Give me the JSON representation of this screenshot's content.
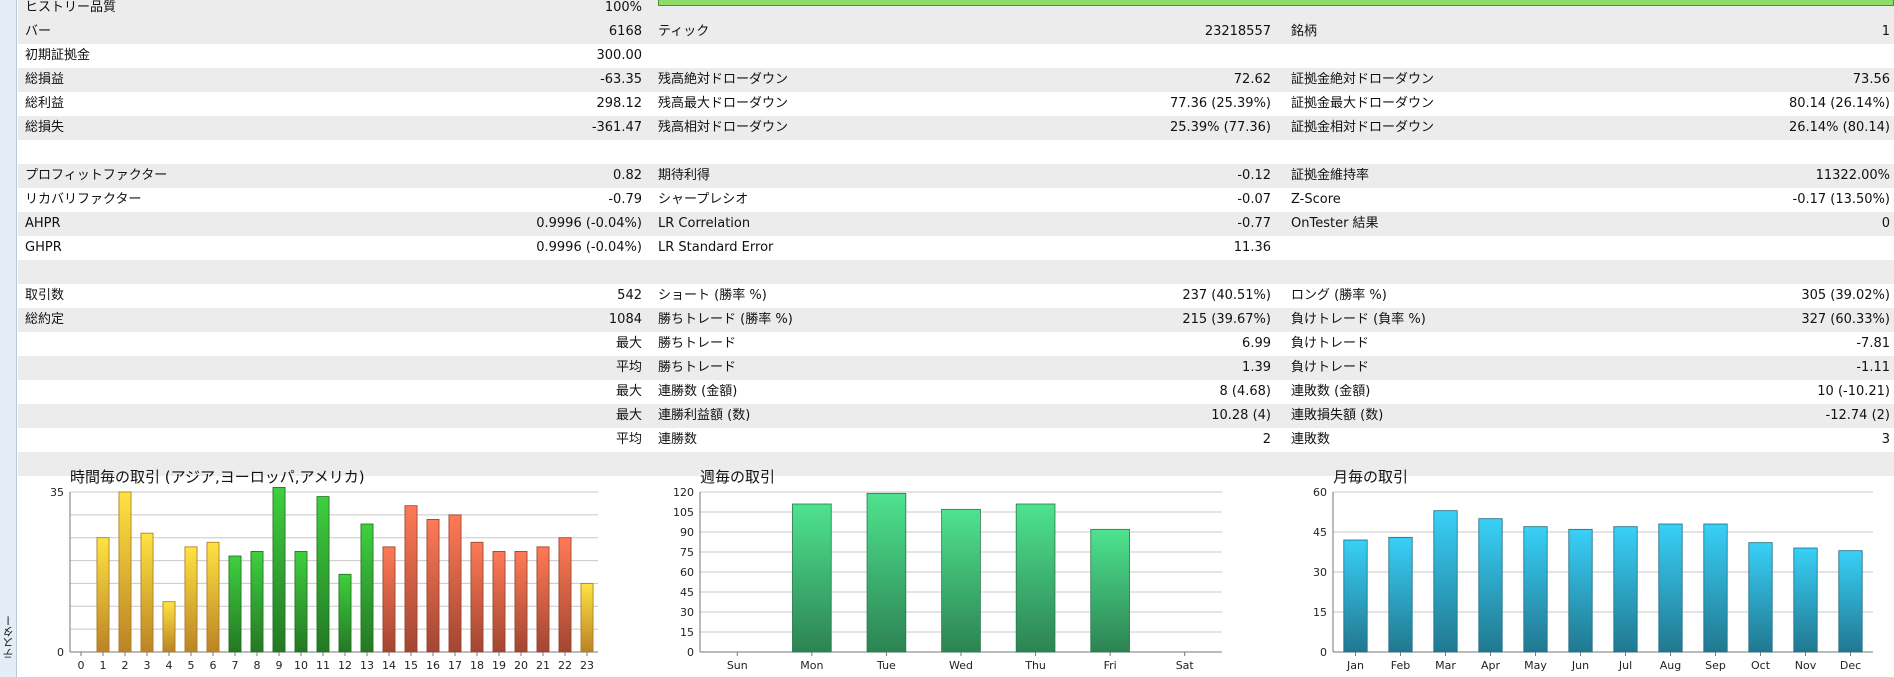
{
  "sidebar": {
    "label": "テスター"
  },
  "report": {
    "rows": [
      {
        "shade": true,
        "cells": [
          "ヒストリー品質",
          "100%",
          "",
          "",
          "",
          ""
        ]
      },
      {
        "shade": true,
        "cells": [
          "バー",
          "6168",
          "ティック",
          "23218557",
          "銘柄",
          "1"
        ]
      },
      {
        "shade": false,
        "cells": [
          "初期証拠金",
          "300.00",
          "",
          "",
          "",
          ""
        ]
      },
      {
        "shade": true,
        "cells": [
          "総損益",
          "-63.35",
          "残高絶対ドローダウン",
          "72.62",
          "証拠金絶対ドローダウン",
          "73.56"
        ]
      },
      {
        "shade": false,
        "cells": [
          "総利益",
          "298.12",
          "残高最大ドローダウン",
          "77.36 (25.39%)",
          "証拠金最大ドローダウン",
          "80.14 (26.14%)"
        ]
      },
      {
        "shade": true,
        "cells": [
          "総損失",
          "-361.47",
          "残高相対ドローダウン",
          "25.39% (77.36)",
          "証拠金相対ドローダウン",
          "26.14% (80.14)"
        ]
      },
      {
        "shade": false,
        "cells": [
          "",
          "",
          "",
          "",
          "",
          ""
        ]
      },
      {
        "shade": true,
        "cells": [
          "プロフィットファクター",
          "0.82",
          "期待利得",
          "-0.12",
          "証拠金維持率",
          "11322.00%"
        ]
      },
      {
        "shade": false,
        "cells": [
          "リカバリファクター",
          "-0.79",
          "シャープレシオ",
          "-0.07",
          "Z-Score",
          "-0.17 (13.50%)"
        ]
      },
      {
        "shade": true,
        "cells": [
          "AHPR",
          "0.9996 (-0.04%)",
          "LR Correlation",
          "-0.77",
          "OnTester 結果",
          "0"
        ]
      },
      {
        "shade": false,
        "cells": [
          "GHPR",
          "0.9996 (-0.04%)",
          "LR Standard Error",
          "11.36",
          "",
          ""
        ]
      },
      {
        "shade": true,
        "cells": [
          "",
          "",
          "",
          "",
          "",
          ""
        ]
      },
      {
        "shade": false,
        "cells": [
          "取引数",
          "542",
          "ショート (勝率 %)",
          "237 (40.51%)",
          "ロング (勝率 %)",
          "305 (39.02%)"
        ]
      },
      {
        "shade": true,
        "cells": [
          "総約定",
          "1084",
          "勝ちトレード (勝率 %)",
          "215 (39.67%)",
          "負けトレード (負率 %)",
          "327 (60.33%)"
        ]
      },
      {
        "shade": false,
        "cells": [
          "",
          "最大",
          "勝ちトレード",
          "6.99",
          "負けトレード",
          "-7.81"
        ]
      },
      {
        "shade": true,
        "cells": [
          "",
          "平均",
          "勝ちトレード",
          "1.39",
          "負けトレード",
          "-1.11"
        ]
      },
      {
        "shade": false,
        "cells": [
          "",
          "最大",
          "連勝数 (金額)",
          "8 (4.68)",
          "連敗数 (金額)",
          "10 (-10.21)"
        ]
      },
      {
        "shade": true,
        "cells": [
          "",
          "最大",
          "連勝利益額 (数)",
          "10.28 (4)",
          "連敗損失額 (数)",
          "-12.74 (2)"
        ]
      },
      {
        "shade": false,
        "cells": [
          "",
          "平均",
          "連勝数",
          "2",
          "連敗数",
          "3"
        ]
      },
      {
        "shade": true,
        "cells": [
          "",
          "",
          "",
          "",
          "",
          ""
        ]
      }
    ]
  },
  "chart_data": [
    {
      "type": "bar",
      "title": "時間毎の取引 (アジア,ヨーロッパ,アメリカ)",
      "categories": [
        "0",
        "1",
        "2",
        "3",
        "4",
        "5",
        "6",
        "7",
        "8",
        "9",
        "10",
        "11",
        "12",
        "13",
        "14",
        "15",
        "16",
        "17",
        "18",
        "19",
        "20",
        "21",
        "22",
        "23"
      ],
      "values": [
        0,
        25,
        35,
        26,
        11,
        23,
        24,
        21,
        22,
        36,
        22,
        34,
        17,
        28,
        23,
        32,
        29,
        30,
        24,
        22,
        22,
        23,
        25,
        15
      ],
      "ylim": [
        0,
        35
      ],
      "yticks": [
        0,
        35
      ],
      "colors": [
        "#f0a830",
        "#f0a830",
        "#f0a830",
        "#f0a830",
        "#f0a830",
        "#f0a830",
        "#f0a830",
        "#2e9a2e",
        "#2e9a2e",
        "#2e9a2e",
        "#2e9a2e",
        "#2e9a2e",
        "#2e9a2e",
        "#2e9a2e",
        "#d05a40",
        "#d05a40",
        "#d05a40",
        "#d05a40",
        "#d05a40",
        "#d05a40",
        "#d05a40",
        "#d05a40",
        "#d05a40",
        "#f0a830"
      ],
      "xlabel": "",
      "ylabel": "",
      "grid": true
    },
    {
      "type": "bar",
      "title": "週毎の取引",
      "categories": [
        "Sun",
        "Mon",
        "Tue",
        "Wed",
        "Thu",
        "Fri",
        "Sat"
      ],
      "values": [
        0,
        111,
        119,
        107,
        111,
        92,
        0
      ],
      "ylim": [
        0,
        120
      ],
      "yticks": [
        0,
        15,
        30,
        45,
        60,
        75,
        90,
        105,
        120
      ],
      "color": "#3aa86a",
      "xlabel": "",
      "ylabel": "",
      "grid": true
    },
    {
      "type": "bar",
      "title": "月毎の取引",
      "categories": [
        "Jan",
        "Feb",
        "Mar",
        "Apr",
        "May",
        "Jun",
        "Jul",
        "Aug",
        "Sep",
        "Oct",
        "Nov",
        "Dec"
      ],
      "values": [
        42,
        43,
        53,
        50,
        47,
        46,
        47,
        48,
        48,
        41,
        39,
        38
      ],
      "ylim": [
        0,
        60
      ],
      "yticks": [
        0,
        15,
        30,
        45,
        60
      ],
      "color": "#2a9ab8",
      "xlabel": "",
      "ylabel": "",
      "grid": true
    }
  ]
}
